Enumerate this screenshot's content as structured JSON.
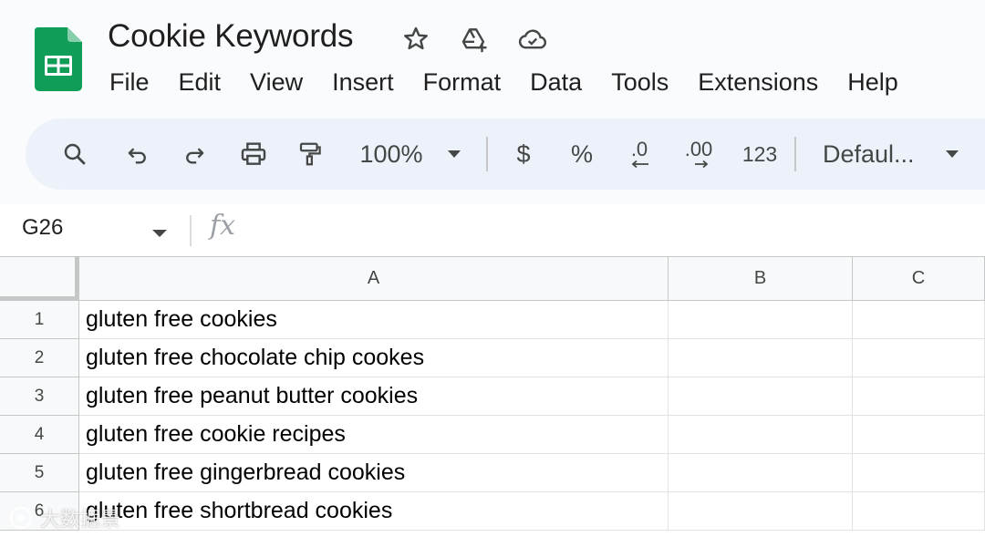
{
  "app": {
    "title": "Cookie Keywords",
    "brand_color": "#0f9d58"
  },
  "title_icons": [
    "star-icon",
    "move-to-drive-icon",
    "cloud-saved-icon"
  ],
  "menu": [
    "File",
    "Edit",
    "View",
    "Insert",
    "Format",
    "Data",
    "Tools",
    "Extensions",
    "Help"
  ],
  "toolbar": {
    "zoom": "100%",
    "currency": "$",
    "percent": "%",
    "decrease_decimal": ".0",
    "increase_decimal": ".00",
    "more_formats": "123",
    "font": "Defaul..."
  },
  "formula_bar": {
    "cell_ref": "G26",
    "fx": "fx",
    "value": ""
  },
  "columns": [
    "A",
    "B",
    "C"
  ],
  "rows": [
    {
      "num": "1",
      "A": "gluten free cookies",
      "B": "",
      "C": ""
    },
    {
      "num": "2",
      "A": "gluten free chocolate chip cookes",
      "B": "",
      "C": ""
    },
    {
      "num": "3",
      "A": "gluten free peanut butter cookies",
      "B": "",
      "C": ""
    },
    {
      "num": "4",
      "A": "gluten free cookie recipes",
      "B": "",
      "C": ""
    },
    {
      "num": "5",
      "A": "gluten free gingerbread cookies",
      "B": "",
      "C": ""
    },
    {
      "num": "6",
      "A": "gluten free shortbread cookies",
      "B": "",
      "C": ""
    }
  ],
  "watermark": "大数据景"
}
